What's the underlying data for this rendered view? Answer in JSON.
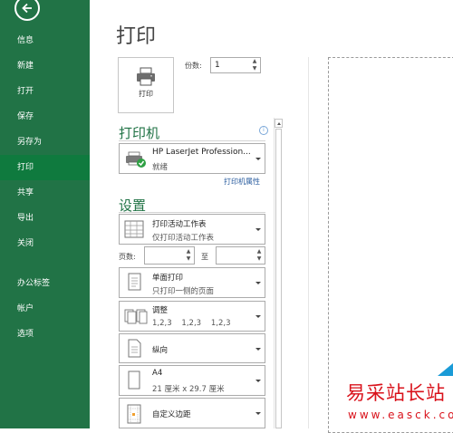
{
  "sidebar": {
    "items": [
      {
        "label": "信息",
        "active": false
      },
      {
        "label": "新建",
        "active": false
      },
      {
        "label": "打开",
        "active": false
      },
      {
        "label": "保存",
        "active": false
      },
      {
        "label": "另存为",
        "active": false
      },
      {
        "label": "打印",
        "active": true
      },
      {
        "label": "共享",
        "active": false
      },
      {
        "label": "导出",
        "active": false
      },
      {
        "label": "关闭",
        "active": false
      },
      {
        "label": "办公标签",
        "active": false
      },
      {
        "label": "帐户",
        "active": false
      },
      {
        "label": "选项",
        "active": false
      }
    ],
    "back_icon": "back-arrow-icon"
  },
  "main": {
    "title": "打印",
    "print_button_label": "打印",
    "copies_label": "份数:",
    "copies_value": "1",
    "printer_section": "打印机",
    "printer_name": "HP LaserJet Profession...",
    "printer_status": "就绪",
    "printer_props_link": "打印机属性",
    "settings_section": "设置",
    "print_what": {
      "title": "打印活动工作表",
      "sub": "仅打印活动工作表"
    },
    "pages_label": "页数:",
    "to_label": "至",
    "sides": {
      "title": "单面打印",
      "sub": "只打印一侧的页面"
    },
    "collate": {
      "title": "调整",
      "sub": "1,2,3    1,2,3    1,2,3"
    },
    "orientation": {
      "title": "纵向"
    },
    "paper": {
      "title": "A4",
      "sub": "21 厘米 x 29.7 厘米"
    },
    "margins": {
      "title": "自定义边距"
    }
  },
  "watermark": {
    "text": "易采站长站",
    "url": "www.easck.com"
  },
  "colors": {
    "sidebar": "#217346",
    "accent": "#217346",
    "link": "#2a5d9f",
    "watermark": "#d9121b"
  }
}
